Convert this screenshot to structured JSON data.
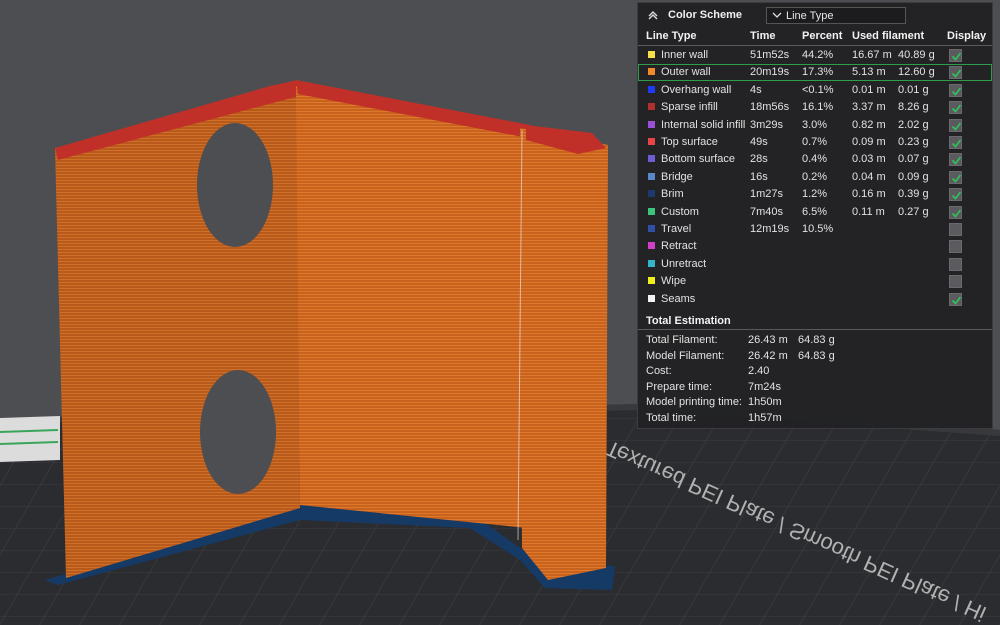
{
  "bed_label": "Textured PEI Plate / Smooth PEI Plate / Hi",
  "color_scheme": {
    "title": "Color Scheme",
    "selected": "Line Type"
  },
  "table": {
    "headers": {
      "line_type": "Line Type",
      "time": "Time",
      "percent": "Percent",
      "used_filament": "Used filament",
      "display": "Display"
    },
    "rows": [
      {
        "color": "#f5e04a",
        "label": "Inner wall",
        "time": "51m52s",
        "percent": "44.2%",
        "length": "16.67 m",
        "weight": "40.89 g",
        "display": true
      },
      {
        "color": "#f08a2c",
        "label": "Outer wall",
        "time": "20m19s",
        "percent": "17.3%",
        "length": "5.13 m",
        "weight": "12.60 g",
        "display": true
      },
      {
        "color": "#1f3af0",
        "label": "Overhang wall",
        "time": "4s",
        "percent": "<0.1%",
        "length": "0.01 m",
        "weight": "0.01 g",
        "display": true
      },
      {
        "color": "#b03030",
        "label": "Sparse infill",
        "time": "18m56s",
        "percent": "16.1%",
        "length": "3.37 m",
        "weight": "8.26 g",
        "display": true
      },
      {
        "color": "#9a4fd6",
        "label": "Internal solid infill",
        "time": "3m29s",
        "percent": "3.0%",
        "length": "0.82 m",
        "weight": "2.02 g",
        "display": true
      },
      {
        "color": "#e84646",
        "label": "Top surface",
        "time": "49s",
        "percent": "0.7%",
        "length": "0.09 m",
        "weight": "0.23 g",
        "display": true
      },
      {
        "color": "#6d5ed0",
        "label": "Bottom surface",
        "time": "28s",
        "percent": "0.4%",
        "length": "0.03 m",
        "weight": "0.07 g",
        "display": true
      },
      {
        "color": "#5a87c8",
        "label": "Bridge",
        "time": "16s",
        "percent": "0.2%",
        "length": "0.04 m",
        "weight": "0.09 g",
        "display": true
      },
      {
        "color": "#1b3a6e",
        "label": "Brim",
        "time": "1m27s",
        "percent": "1.2%",
        "length": "0.16 m",
        "weight": "0.39 g",
        "display": true
      },
      {
        "color": "#3cc47f",
        "label": "Custom",
        "time": "7m40s",
        "percent": "6.5%",
        "length": "0.11 m",
        "weight": "0.27 g",
        "display": true
      },
      {
        "color": "#3050a8",
        "label": "Travel",
        "time": "12m19s",
        "percent": "10.5%",
        "length": "",
        "weight": "",
        "display": false
      },
      {
        "color": "#d13fc9",
        "label": "Retract",
        "time": "",
        "percent": "",
        "length": "",
        "weight": "",
        "display": false
      },
      {
        "color": "#35b4c8",
        "label": "Unretract",
        "time": "",
        "percent": "",
        "length": "",
        "weight": "",
        "display": false
      },
      {
        "color": "#f2ee1c",
        "label": "Wipe",
        "time": "",
        "percent": "",
        "length": "",
        "weight": "",
        "display": false
      },
      {
        "color": "#f2f2f2",
        "label": "Seams",
        "time": "",
        "percent": "",
        "length": "",
        "weight": "",
        "display": true
      }
    ]
  },
  "total": {
    "title": "Total Estimation",
    "rows": [
      {
        "key": "Total Filament:",
        "v1": "26.43 m",
        "v2": "64.83 g"
      },
      {
        "key": "Model Filament:",
        "v1": "26.42 m",
        "v2": "64.83 g"
      },
      {
        "key": "Cost:",
        "v1": "2.40",
        "v2": ""
      },
      {
        "key": "Prepare time:",
        "v1": "7m24s",
        "v2": ""
      },
      {
        "key": "Model printing time:",
        "v1": "1h50m",
        "v2": ""
      },
      {
        "key": "Total time:",
        "v1": "1h57m",
        "v2": ""
      }
    ]
  }
}
